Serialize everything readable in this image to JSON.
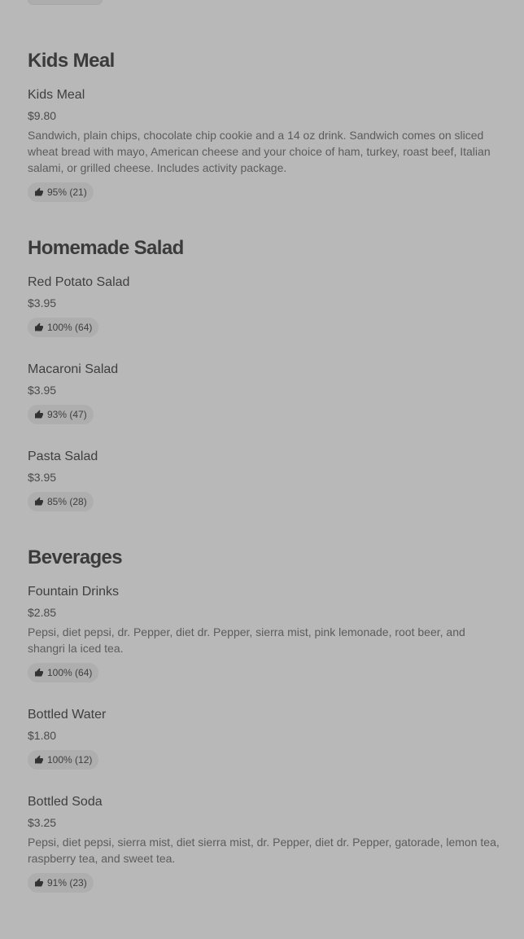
{
  "sections": [
    {
      "title": "Kids Meal",
      "items": [
        {
          "name": "Kids Meal",
          "price": "$9.80",
          "description": "Sandwich, plain chips, chocolate chip cookie and a 14 oz drink. Sandwich comes on sliced wheat bread with mayo, American cheese and your choice of ham, turkey, roast beef, Italian salami, or grilled cheese. Includes activity package.",
          "rating": "95% (21)"
        }
      ]
    },
    {
      "title": "Homemade Salad",
      "items": [
        {
          "name": "Red Potato Salad",
          "price": "$3.95",
          "rating": "100% (64)"
        },
        {
          "name": "Macaroni Salad",
          "price": "$3.95",
          "rating": "93% (47)"
        },
        {
          "name": "Pasta Salad",
          "price": "$3.95",
          "rating": "85% (28)"
        }
      ]
    },
    {
      "title": "Beverages",
      "items": [
        {
          "name": "Fountain Drinks",
          "price": "$2.85",
          "description": "Pepsi, diet pepsi, dr. Pepper, diet dr. Pepper, sierra mist, pink lemonade, root beer, and shangri la iced tea.",
          "rating": "100% (64)"
        },
        {
          "name": "Bottled Water",
          "price": "$1.80",
          "rating": "100% (12)"
        },
        {
          "name": "Bottled Soda",
          "price": "$3.25",
          "description": "Pepsi, diet pepsi, sierra mist, diet sierra mist, dr. Pepper, diet dr. Pepper, gatorade, lemon tea, raspberry tea, and sweet tea.",
          "rating": "91% (23)"
        }
      ]
    }
  ],
  "icons": {
    "rating": "thumbs-up-icon"
  }
}
